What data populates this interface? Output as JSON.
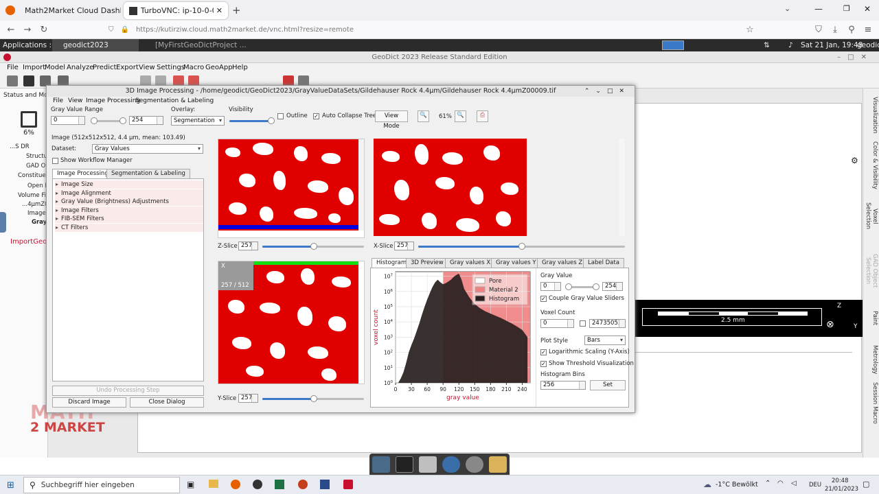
{
  "browser": {
    "tabs": [
      {
        "label": "Math2Market Cloud Dashboard (wo"
      },
      {
        "label": "TurboVNC: ip-10-0-0-245 (geo"
      }
    ],
    "url": "https://kutirziw.cloud.math2market.de/vnc.html?resize=remote"
  },
  "vnc_panel": {
    "applications": "Applications :",
    "window1": "geodict2023",
    "window2": "[MyFirstGeoDictProject ...",
    "datetime": "Sat 21 Jan, 19:48",
    "user": "geodict"
  },
  "geodict": {
    "title": "GeoDict 2023 Release Standard Edition",
    "menu": [
      "File",
      "Import",
      "Model",
      "Analyze",
      "Predict",
      "Export",
      "View",
      "Settings",
      "Macro",
      "GeoApp",
      "Help"
    ],
    "left_header": "Status and Modu",
    "progress": "6%",
    "tree": [
      "...S DR",
      "Structu",
      "GAD O",
      "Constituen",
      "Open F",
      "Volume File",
      "...4µmZ0",
      "Image",
      "Gray"
    ],
    "import_label": "ImportGeo-",
    "logo_line1": "MATH",
    "logo_line2": "2 MARKET",
    "scale": "2.5 mm",
    "axis_z": "Z",
    "axis_y": "Y",
    "right_tabs": [
      "Visualization",
      "Color & Visibility",
      "Voxel Selection",
      "GAD Object Selection",
      "Paint",
      "Metrology",
      "Session Macro"
    ]
  },
  "dialog": {
    "title": "3D Image Processing - /home/geodict/GeoDict2023/GrayValueDataSets/Gildehauser Rock 4.4µm/Gildehauser Rock 4.4µmZ00009.tif",
    "menu": [
      "File",
      "View",
      "Image Processing",
      "Segmentation & Labeling"
    ],
    "gray_value_range_label": "Gray Value Range",
    "range_min": "0",
    "range_max": "254",
    "overlay_label": "Overlay:",
    "overlay_value": "Segmentation",
    "visibility_label": "Visibility",
    "outline_label": "Outline",
    "auto_collapse_label": "Auto Collapse Tree",
    "view_mode_label": "View Mode",
    "zoom": "61%",
    "image_info": "Image (512x512x512, 4.4 µm, mean: 103.49)",
    "dataset_label": "Dataset:",
    "dataset_value": "Gray Values",
    "show_workflow": "Show Workflow Manager",
    "left_tabs": [
      "Image Processing",
      "Segmentation & Labeling"
    ],
    "processing_items": [
      "Image Size",
      "Image Alignment",
      "Gray Value (Brightness) Adjustments",
      "Image Filters",
      "FIB-SEM Filters",
      "CT Filters"
    ],
    "undo_label": "Undo Processing Step",
    "discard_label": "Discard Image",
    "close_label": "Close Dialog",
    "zslice_label": "Z-Slice",
    "zslice_value": "257",
    "xslice_label": "X-Slice",
    "xslice_value": "257",
    "yslice_label": "Y-Slice",
    "yslice_value": "257",
    "slice_readout": "257 / 512",
    "slice_axis": "X",
    "hist_tabs": [
      "Histogram",
      "3D Preview",
      "Gray values X",
      "Gray values Y",
      "Gray values Z",
      "Label Data"
    ],
    "hist_settings": {
      "gray_value_label": "Gray Value",
      "gray_min": "0",
      "gray_max": "254",
      "couple_label": "Couple Gray Value Sliders",
      "voxel_count_label": "Voxel Count",
      "voxel_min": "0",
      "voxel_max": "24735053",
      "plot_style_label": "Plot Style",
      "plot_style_value": "Bars",
      "log_label": "Logarithmic Scaling (Y-Axis)",
      "threshold_label": "Show Threshold Visualization",
      "bins_label": "Histogram Bins",
      "bins_value": "256",
      "set_label": "Set"
    }
  },
  "chart_data": {
    "type": "bar",
    "xlabel": "gray value",
    "ylabel": "voxel count",
    "x_ticks": [
      0,
      30,
      60,
      90,
      120,
      150,
      180,
      210,
      240
    ],
    "y_ticks": [
      "10^0",
      "10^1",
      "10^2",
      "10^3",
      "10^4",
      "10^5",
      "10^6",
      "10^7"
    ],
    "log_scale_y": true,
    "threshold": 90,
    "xlim": [
      0,
      255
    ],
    "legend": [
      "Pore",
      "Material 2",
      "Histogram"
    ],
    "legend_position": "top-right",
    "colors": {
      "pore": "#ffffff",
      "material": "#f08080",
      "histogram": "#2a2020"
    },
    "series": [
      {
        "name": "Histogram",
        "x": [
          5,
          10,
          15,
          20,
          25,
          30,
          35,
          40,
          45,
          50,
          55,
          60,
          65,
          70,
          75,
          80,
          85,
          90,
          95,
          100,
          105,
          110,
          115,
          120,
          125,
          130,
          140,
          150,
          160,
          170,
          180,
          190,
          200,
          210,
          220,
          230,
          240,
          250
        ],
        "values": [
          1,
          2,
          5,
          20,
          100,
          300,
          800,
          2500,
          8000,
          30000,
          100000,
          300000,
          800000,
          2000000,
          4000000,
          6000000,
          4000000,
          3000000,
          3500000,
          4500000,
          6000000,
          9000000,
          12000000,
          15000000,
          6000000,
          1500000,
          400000,
          150000,
          80000,
          50000,
          35000,
          25000,
          18000,
          12000,
          8000,
          5000,
          3000,
          1000
        ]
      }
    ]
  },
  "taskbar": {
    "search": "Suchbegriff hier eingeben",
    "weather": "-1°C  Bewölkt",
    "lang": "DEU",
    "time": "20:48",
    "date": "21/01/2023"
  }
}
